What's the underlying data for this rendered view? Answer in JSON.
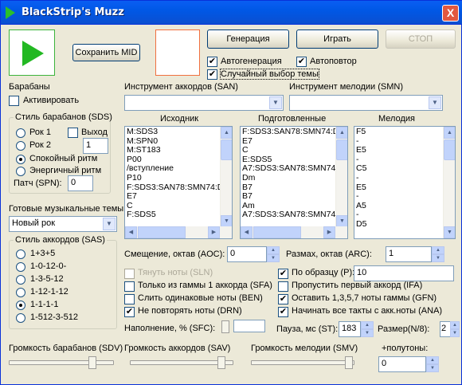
{
  "window": {
    "title": "BlackStrip's Muzz",
    "close": "X"
  },
  "toolbar": {
    "save_mid": "Сохранить MID",
    "generate": "Генерация",
    "play": "Играть",
    "stop": "СТОП"
  },
  "options_top": {
    "autogen": "Автогенерация",
    "autorepeat": "Автоповтор",
    "random_theme": "Случайный выбор темы"
  },
  "drums": {
    "heading": "Барабаны",
    "activate": "Активировать",
    "style_group": "Стиль барабанов (SDS)",
    "styles": [
      "Рок 1",
      "Рок 2",
      "Спокойный ритм",
      "Энергичный ритм"
    ],
    "selected_style": "Спокойный ритм",
    "exit_label": "Выход",
    "exit_value": "1",
    "patch_label": "Патч (SPN):",
    "patch_value": "0"
  },
  "themes": {
    "label": "Готовые музыкальные темы",
    "selected": "Новый рок"
  },
  "chords_style": {
    "group": "Стиль аккордов (SAS)",
    "options": [
      "1+3+5",
      "1-0-12-0-",
      "1-3-5-12",
      "1-12-1-12",
      "1-1-1-1",
      "1-512-3-512"
    ],
    "selected": "1-1-1-1"
  },
  "instruments": {
    "chords_label": "Инструмент аккордов (SAN)",
    "chords_value": "",
    "melody_label": "Инструмент мелодии (SMN)",
    "melody_value": ""
  },
  "lists": {
    "source_title": "Исходник",
    "source_items": [
      "M:SDS3",
      "M:SPN0",
      "M:ST183",
      "P00",
      "/вступление",
      "P10",
      "F:SDS3:SAN78:SMN74:D",
      "E7",
      "C",
      "F:SDS5"
    ],
    "prepared_title": "Подготовленные",
    "prepared_items": [
      "F:SDS3:SAN78:SMN74:D",
      "E7",
      "C",
      "E:SDS5",
      "A7:SDS3:SAN78:SMN74",
      "Dm",
      "B7",
      "B7",
      "Am",
      "A7:SDS3:SAN78:SMN74"
    ],
    "melody_title": "Мелодия",
    "melody_items": [
      "F5",
      "-",
      "E5",
      "-",
      "C5",
      "-",
      "E5",
      "-",
      "A5",
      "-",
      "D5"
    ]
  },
  "params": {
    "octave_shift_label": "Смещение, октав (AOC):",
    "octave_shift_value": "0",
    "octave_range_label": "Размах, октав (ARC):",
    "octave_range_value": "1",
    "pull_notes": "Тянуть ноты (SLN)",
    "by_pattern": "По образцу (P):",
    "by_pattern_value": "10",
    "only_scale": "Только из гаммы 1 аккорда (SFA)",
    "skip_first": "Пропустить первый аккорд (IFA)",
    "merge_same": "Слить одинаковые ноты (BEN)",
    "keep_1357": "Оставить 1,3,5,7 ноты гаммы (GFN)",
    "no_repeat": "Не повторять ноты (DRN)",
    "start_all": "Начинать все такты с акк.ноты (ANA)",
    "fill_label": "Наполнение, % (SFC):",
    "pause_label": "Пауза, мс (ST):",
    "pause_value": "183",
    "size_label": "Размер(N/8):",
    "size_value": "2"
  },
  "volumes": {
    "drums": "Громкость барабанов (SDV)",
    "chords": "Громкость аккордов (SAV)",
    "melody": "Громкость мелодии (SMV)",
    "semitones_label": "+полутоны:",
    "semitones_value": "0"
  },
  "colors": {
    "title_bar": "#0058e6",
    "play_icon": "#22b822",
    "window_bg": "#ece9d8"
  }
}
